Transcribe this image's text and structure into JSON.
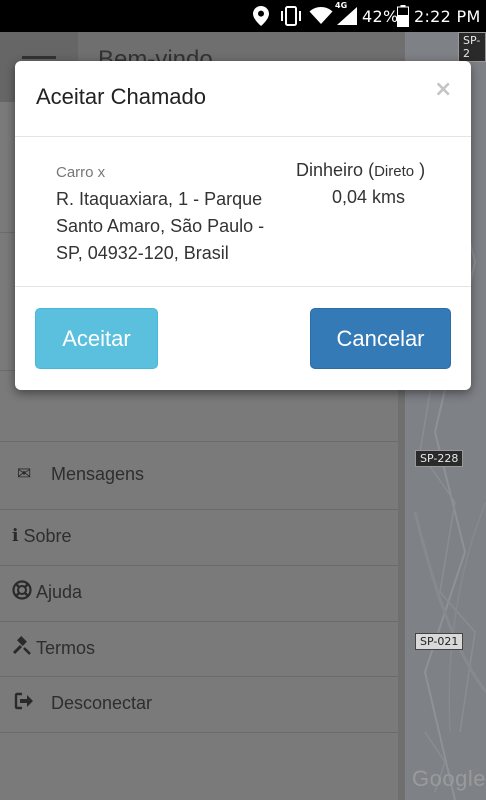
{
  "status_bar": {
    "network_label": "4G",
    "battery": "42%",
    "time": "2:22 PM",
    "icons": [
      "location-icon",
      "vibrate-icon",
      "wifi-icon",
      "signal-icon",
      "battery-icon"
    ]
  },
  "app": {
    "header_title_partial": "Bem-vindo",
    "menu": [
      {
        "label": "Mensagens",
        "icon": "envelope-icon"
      },
      {
        "label": "Sobre",
        "icon": "info-icon"
      },
      {
        "label": "Ajuda",
        "icon": "lifebuoy-icon"
      },
      {
        "label": "Termos",
        "icon": "gavel-icon"
      },
      {
        "label": "Desconectar",
        "icon": "sign-out-icon"
      }
    ]
  },
  "map": {
    "road_labels": [
      "SP-2",
      "SP-228",
      "SP-021"
    ],
    "logo": "Google"
  },
  "modal": {
    "title": "Aceitar Chamado",
    "close_symbol": "×",
    "car": "Carro x",
    "address": "R. Itaquaxiara, 1 - Parque Santo Amaro, São Paulo - SP, 04932-120, Brasil",
    "payment_method": "Dinheiro",
    "payment_open": "(",
    "payment_type": "Direto",
    "payment_close": ")",
    "distance": "0,04 kms",
    "accept_label": "Aceitar",
    "cancel_label": "Cancelar"
  },
  "colors": {
    "accept": "#5bc0de",
    "cancel": "#337ab7",
    "backdrop": "#7b7b7b"
  }
}
